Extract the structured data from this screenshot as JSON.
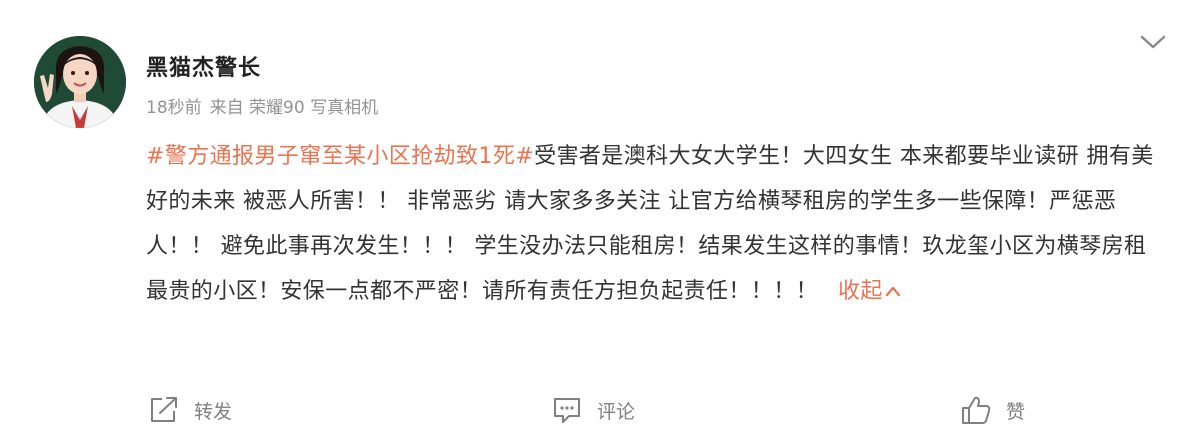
{
  "post": {
    "username": "黑猫杰警长",
    "time": "18秒前",
    "source": "来自 荣耀90 写真相机",
    "hashtag": "#警方通报男子窜至某小区抢劫致1死#",
    "body": "受害者是澳科大女大学生！大四女生 本来都要毕业读研 拥有美好的未来 被恶人所害！！ 非常恶劣 请大家多多关注 让官方给横琴租房的学生多一些保障！严惩恶人！！ 避免此事再次发生！！！ 学生没办法只能租房！结果发生这样的事情！玖龙玺小区为横琴房租最贵的小区！安保一点都不严密！请所有责任方担负起责任！！！！",
    "collapse_label": "收起",
    "avatar_icon": "user-avatar",
    "menu_icon": "chevron-down-icon"
  },
  "actions": {
    "forward_label": "转发",
    "comment_label": "评论",
    "like_label": "赞"
  },
  "colors": {
    "accent": "#eb7350",
    "text": "#333333",
    "meta": "#939393",
    "icon": "#808080"
  }
}
